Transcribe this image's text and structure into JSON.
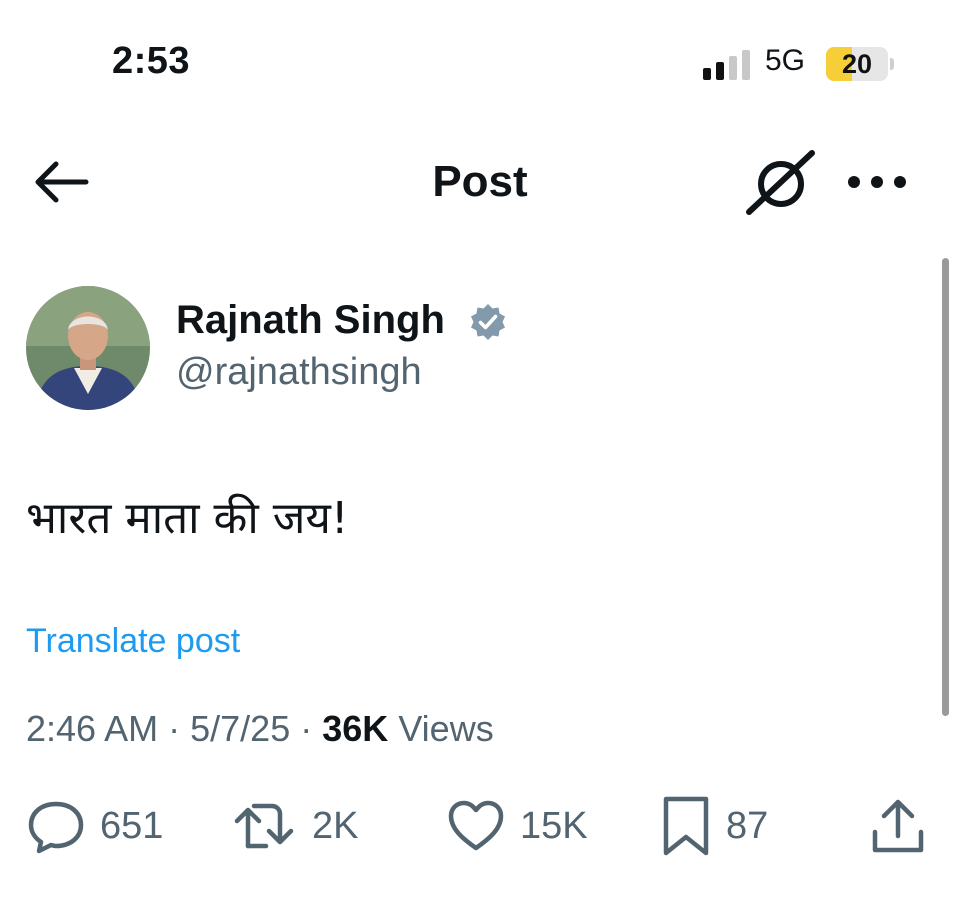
{
  "status_bar": {
    "time": "2:53",
    "network": "5G",
    "battery": "20",
    "battery_percent": 20
  },
  "header": {
    "title": "Post",
    "icons": [
      "back-arrow-icon",
      "grok-icon",
      "more-options-icon"
    ]
  },
  "post": {
    "author": {
      "name": "Rajnath Singh",
      "handle": "@rajnathsingh",
      "verified_badge": "verified-badge-icon"
    },
    "text": "भारत माता की जय!",
    "translate_label": "Translate post",
    "meta": {
      "time": "2:46 AM",
      "date": "5/7/25",
      "views_count": "36K",
      "views_label": "Views",
      "separator": "·"
    },
    "actions": {
      "reply": "651",
      "repost": "2K",
      "like": "15K",
      "bookmark": "87"
    }
  },
  "colors": {
    "accent": "#1d9bf0",
    "secondary_text": "#536471",
    "primary_text": "#0f1419",
    "verified_badge": "#829aab",
    "battery_fill": "#f6cf38"
  }
}
